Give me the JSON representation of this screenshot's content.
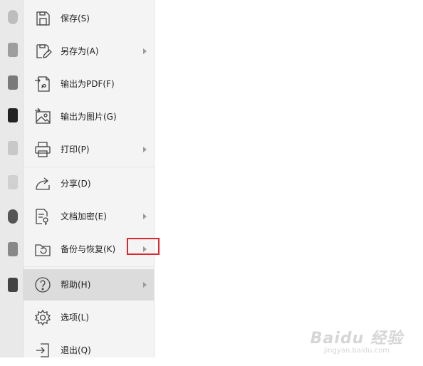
{
  "menu": {
    "items": [
      {
        "label": "保存(S)",
        "icon": "save-icon",
        "has_submenu": false
      },
      {
        "label": "另存为(A)",
        "icon": "save-as-icon",
        "has_submenu": true
      },
      {
        "label": "输出为PDF(F)",
        "icon": "export-pdf-icon",
        "has_submenu": false
      },
      {
        "label": "输出为图片(G)",
        "icon": "export-image-icon",
        "has_submenu": false
      },
      {
        "label": "打印(P)",
        "icon": "printer-icon",
        "has_submenu": true
      },
      {
        "label": "分享(D)",
        "icon": "share-icon",
        "has_submenu": false
      },
      {
        "label": "文档加密(E)",
        "icon": "encrypt-document-icon",
        "has_submenu": true
      },
      {
        "label": "备份与恢复(K)",
        "icon": "backup-restore-icon",
        "has_submenu": true
      },
      {
        "label": "帮助(H)",
        "icon": "help-icon",
        "has_submenu": true,
        "active": true
      },
      {
        "label": "选项(L)",
        "icon": "gear-icon",
        "has_submenu": false
      },
      {
        "label": "退出(Q)",
        "icon": "exit-icon",
        "has_submenu": false
      }
    ]
  },
  "annotation": {
    "highlight_color": "#e0262c"
  },
  "watermark": {
    "main": "Baidu 经验",
    "sub": "jingyan.baidu.com"
  }
}
